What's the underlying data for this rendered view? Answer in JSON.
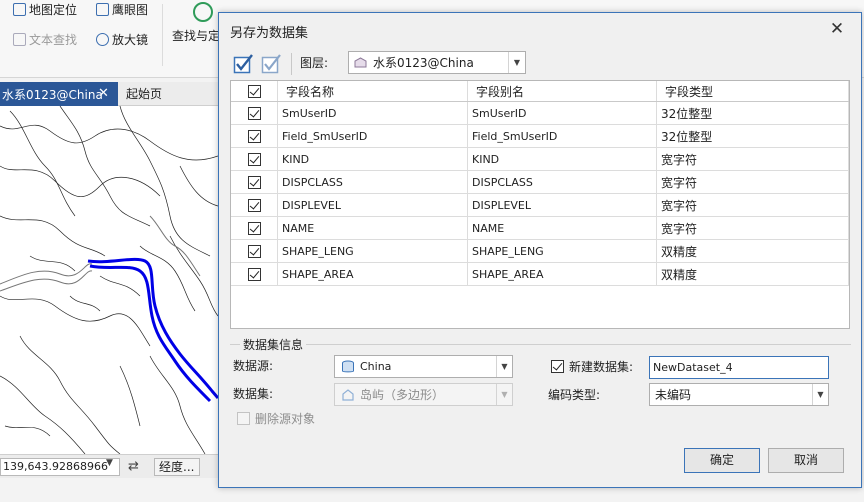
{
  "ribbon": {
    "map_locate": "地图定位",
    "eagle_eye": "鹰眼图",
    "text_search": "文本查找",
    "magnifier": "放大镜",
    "find_label": "查找与定"
  },
  "map_tabs": {
    "active_tab": "水系0123@China",
    "close_glyph": "✕",
    "start_page": "起始页"
  },
  "status": {
    "coordinates": "139,643.92868966",
    "degree_label": "经度..."
  },
  "dialog": {
    "title": "另存为数据集",
    "close_glyph": "✕",
    "layer_label": "图层:",
    "layer_value": "水系0123@China",
    "columns": [
      "字段名称",
      "字段别名",
      "字段类型"
    ],
    "fields": [
      {
        "name": "SmUserID",
        "alias": "SmUserID",
        "type": "32位整型",
        "checked": true
      },
      {
        "name": "Field_SmUserID",
        "alias": "Field_SmUserID",
        "type": "32位整型",
        "checked": true
      },
      {
        "name": "KIND",
        "alias": "KIND",
        "type": "宽字符",
        "checked": true
      },
      {
        "name": "DISPCLASS",
        "alias": "DISPCLASS",
        "type": "宽字符",
        "checked": true
      },
      {
        "name": "DISPLEVEL",
        "alias": "DISPLEVEL",
        "type": "宽字符",
        "checked": true
      },
      {
        "name": "NAME",
        "alias": "NAME",
        "type": "宽字符",
        "checked": true
      },
      {
        "name": "SHAPE_LENG",
        "alias": "SHAPE_LENG",
        "type": "双精度",
        "checked": true
      },
      {
        "name": "SHAPE_AREA",
        "alias": "SHAPE_AREA",
        "type": "双精度",
        "checked": true
      }
    ],
    "dataset_info": {
      "group_title": "数据集信息",
      "datasource_label": "数据源:",
      "datasource_value": "China",
      "dataset_label": "数据集:",
      "dataset_value": "岛屿（多边形）",
      "new_dataset_label": "新建数据集:",
      "new_dataset_checked": true,
      "new_dataset_value": "NewDataset_4",
      "encoding_label": "编码类型:",
      "encoding_value": "未编码",
      "delete_source_label": "删除源对象",
      "delete_source_checked": false
    },
    "ok_label": "确定",
    "cancel_label": "取消"
  },
  "colors": {
    "accent": "#3b74b8",
    "tab_active": "#2b5797",
    "river": "#0000e6"
  }
}
